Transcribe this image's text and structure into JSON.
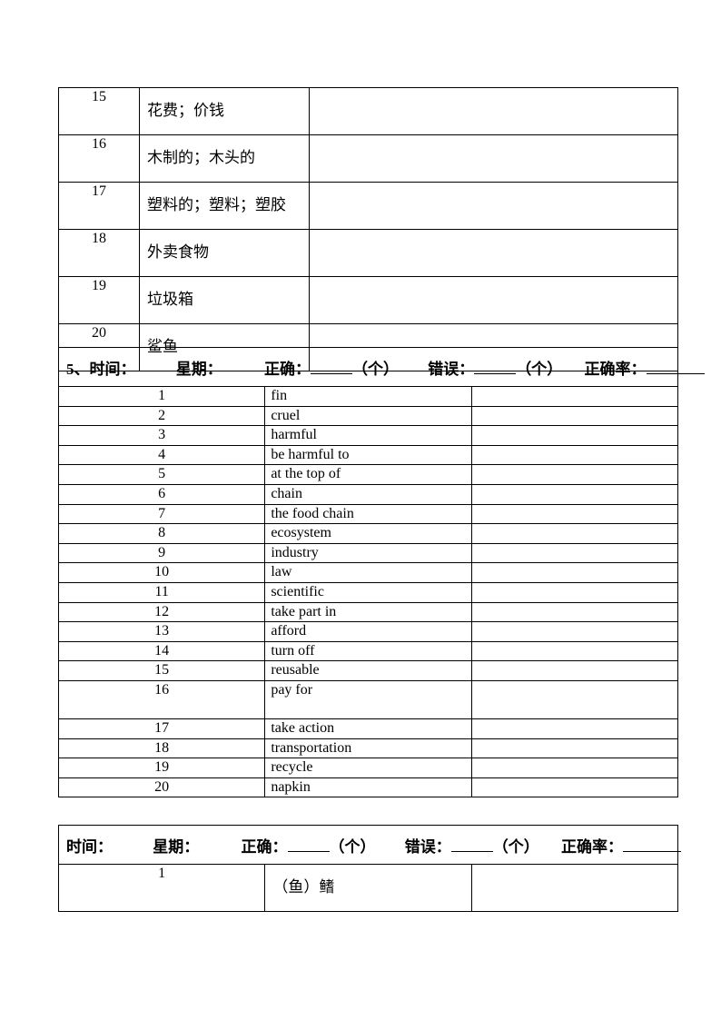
{
  "table1": {
    "rows": [
      {
        "num": "15",
        "word": "花费；价钱",
        "answer": ""
      },
      {
        "num": "16",
        "word": "木制的；木头的",
        "answer": ""
      },
      {
        "num": "17",
        "word": "塑料的；塑料；塑胶",
        "answer": ""
      },
      {
        "num": "18",
        "word": "外卖食物",
        "answer": ""
      },
      {
        "num": "19",
        "word": "垃圾箱",
        "answer": ""
      },
      {
        "num": "20",
        "word": "鲨鱼",
        "answer": ""
      }
    ]
  },
  "table2": {
    "header": {
      "time_label": "5、时间：",
      "weekday_label": "星期：",
      "correct_label": "正确：",
      "correct_unit": "（个）",
      "wrong_label": "错误：",
      "wrong_unit": "（个）",
      "rate_label": "正确率："
    },
    "rows": [
      {
        "num": "1",
        "word": "fin",
        "answer": ""
      },
      {
        "num": "2",
        "word": "cruel",
        "answer": ""
      },
      {
        "num": "3",
        "word": "harmful",
        "answer": ""
      },
      {
        "num": "4",
        "word": "be harmful to",
        "answer": ""
      },
      {
        "num": "5",
        "word": "at the top of",
        "answer": ""
      },
      {
        "num": "6",
        "word": "chain",
        "answer": ""
      },
      {
        "num": "7",
        "word": "the food chain",
        "answer": ""
      },
      {
        "num": "8",
        "word": "ecosystem",
        "answer": ""
      },
      {
        "num": "9",
        "word": "industry",
        "answer": ""
      },
      {
        "num": "10",
        "word": "law",
        "answer": ""
      },
      {
        "num": "11",
        "word": "scientific",
        "answer": ""
      },
      {
        "num": "12",
        "word": "take part in",
        "answer": ""
      },
      {
        "num": "13",
        "word": "afford",
        "answer": ""
      },
      {
        "num": "14",
        "word": "turn off",
        "answer": ""
      },
      {
        "num": "15",
        "word": "reusable",
        "answer": ""
      },
      {
        "num": "16",
        "word": "pay for",
        "answer": ""
      },
      {
        "num": "17",
        "word": "take action",
        "answer": ""
      },
      {
        "num": "18",
        "word": "transportation",
        "answer": ""
      },
      {
        "num": "19",
        "word": "recycle",
        "answer": ""
      },
      {
        "num": "20",
        "word": "napkin",
        "answer": ""
      }
    ]
  },
  "table3": {
    "header": {
      "time_label": "时间：",
      "weekday_label": "星期：",
      "correct_label": "正确：",
      "correct_unit": "（个）",
      "wrong_label": "错误：",
      "wrong_unit": "（个）",
      "rate_label": "正确率："
    },
    "rows": [
      {
        "num": "1",
        "word": "（鱼）鳍",
        "answer": ""
      }
    ]
  }
}
